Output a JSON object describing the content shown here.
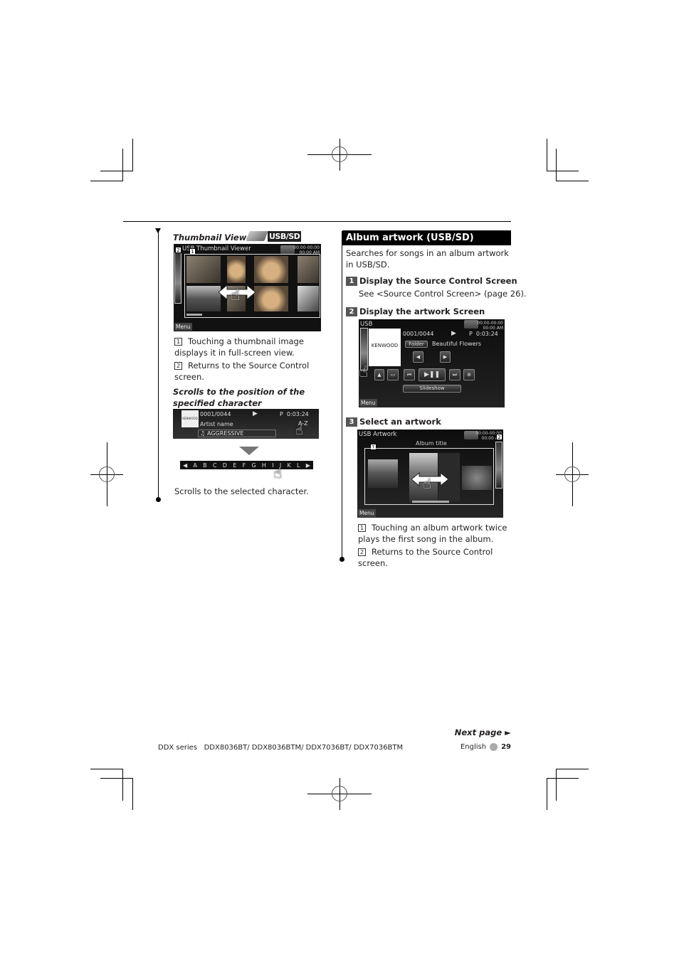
{
  "left_column": {
    "thumbnail_viewer": {
      "heading": "Thumbnail Viewer",
      "badge": "USB/SD",
      "screen": {
        "title": "USB Thumbnail Viewer",
        "clock_line1": "00:00-00:00",
        "clock_line2": "00:00 AM",
        "menu_label": "Menu",
        "callouts": [
          "1",
          "2"
        ]
      },
      "notes": [
        {
          "num": "1",
          "text": "Touching a thumbnail image displays it in full-screen view."
        },
        {
          "num": "2",
          "text": "Returns to the Source Control screen."
        }
      ]
    },
    "scroll_section": {
      "heading": "Scrolls to the position of the specified character",
      "screen": {
        "track": "0001/0044",
        "play_icon": "play-icon",
        "time": "P  0:03:24",
        "artist": "Artist name",
        "az_label": "A-Z",
        "genre": "AGGRESSIVE",
        "logo": "KENWOOD"
      },
      "alphabet": [
        "A",
        "B",
        "C",
        "D",
        "E",
        "F",
        "G",
        "H",
        "I",
        "J",
        "K",
        "L"
      ],
      "caption": "Scrolls to the selected character."
    }
  },
  "right_column": {
    "section_title": "Album artwork (USB/SD)",
    "intro": "Searches for songs in an album artwork in USB/SD.",
    "steps": [
      {
        "num": "1",
        "title": "Display the Source Control Screen",
        "detail": "See <Source Control Screen> (page 26)."
      },
      {
        "num": "2",
        "title": "Display the artwork Screen"
      },
      {
        "num": "3",
        "title": "Select an artwork"
      }
    ],
    "source_screen": {
      "title": "USB",
      "clock_line1": "00:00-00:00",
      "clock_line2": "00:00 AM",
      "track": "0001/0044",
      "time": "P  0:03:24",
      "folder_label": "Folder",
      "song": "Beautiful Flowers",
      "logo": "KENWOOD",
      "slideshow_label": "Slideshow",
      "menu_label": "Menu"
    },
    "artwork_screen": {
      "title": "USB Artwork",
      "album_title": "Album title",
      "clock_line1": "00:00-00:00",
      "clock_line2": "00:00 AM",
      "menu_label": "Menu",
      "callouts": [
        "1",
        "2"
      ]
    },
    "notes": [
      {
        "num": "1",
        "text": "Touching an album artwork twice plays the first song in the album."
      },
      {
        "num": "2",
        "text": "Returns to the Source Control screen."
      }
    ]
  },
  "footer": {
    "next_page": "Next page",
    "series": "DDX series   DDX8036BT/ DDX8036BTM/ DDX7036BT/ DDX7036BTM",
    "language": "English",
    "page_number": "29"
  }
}
